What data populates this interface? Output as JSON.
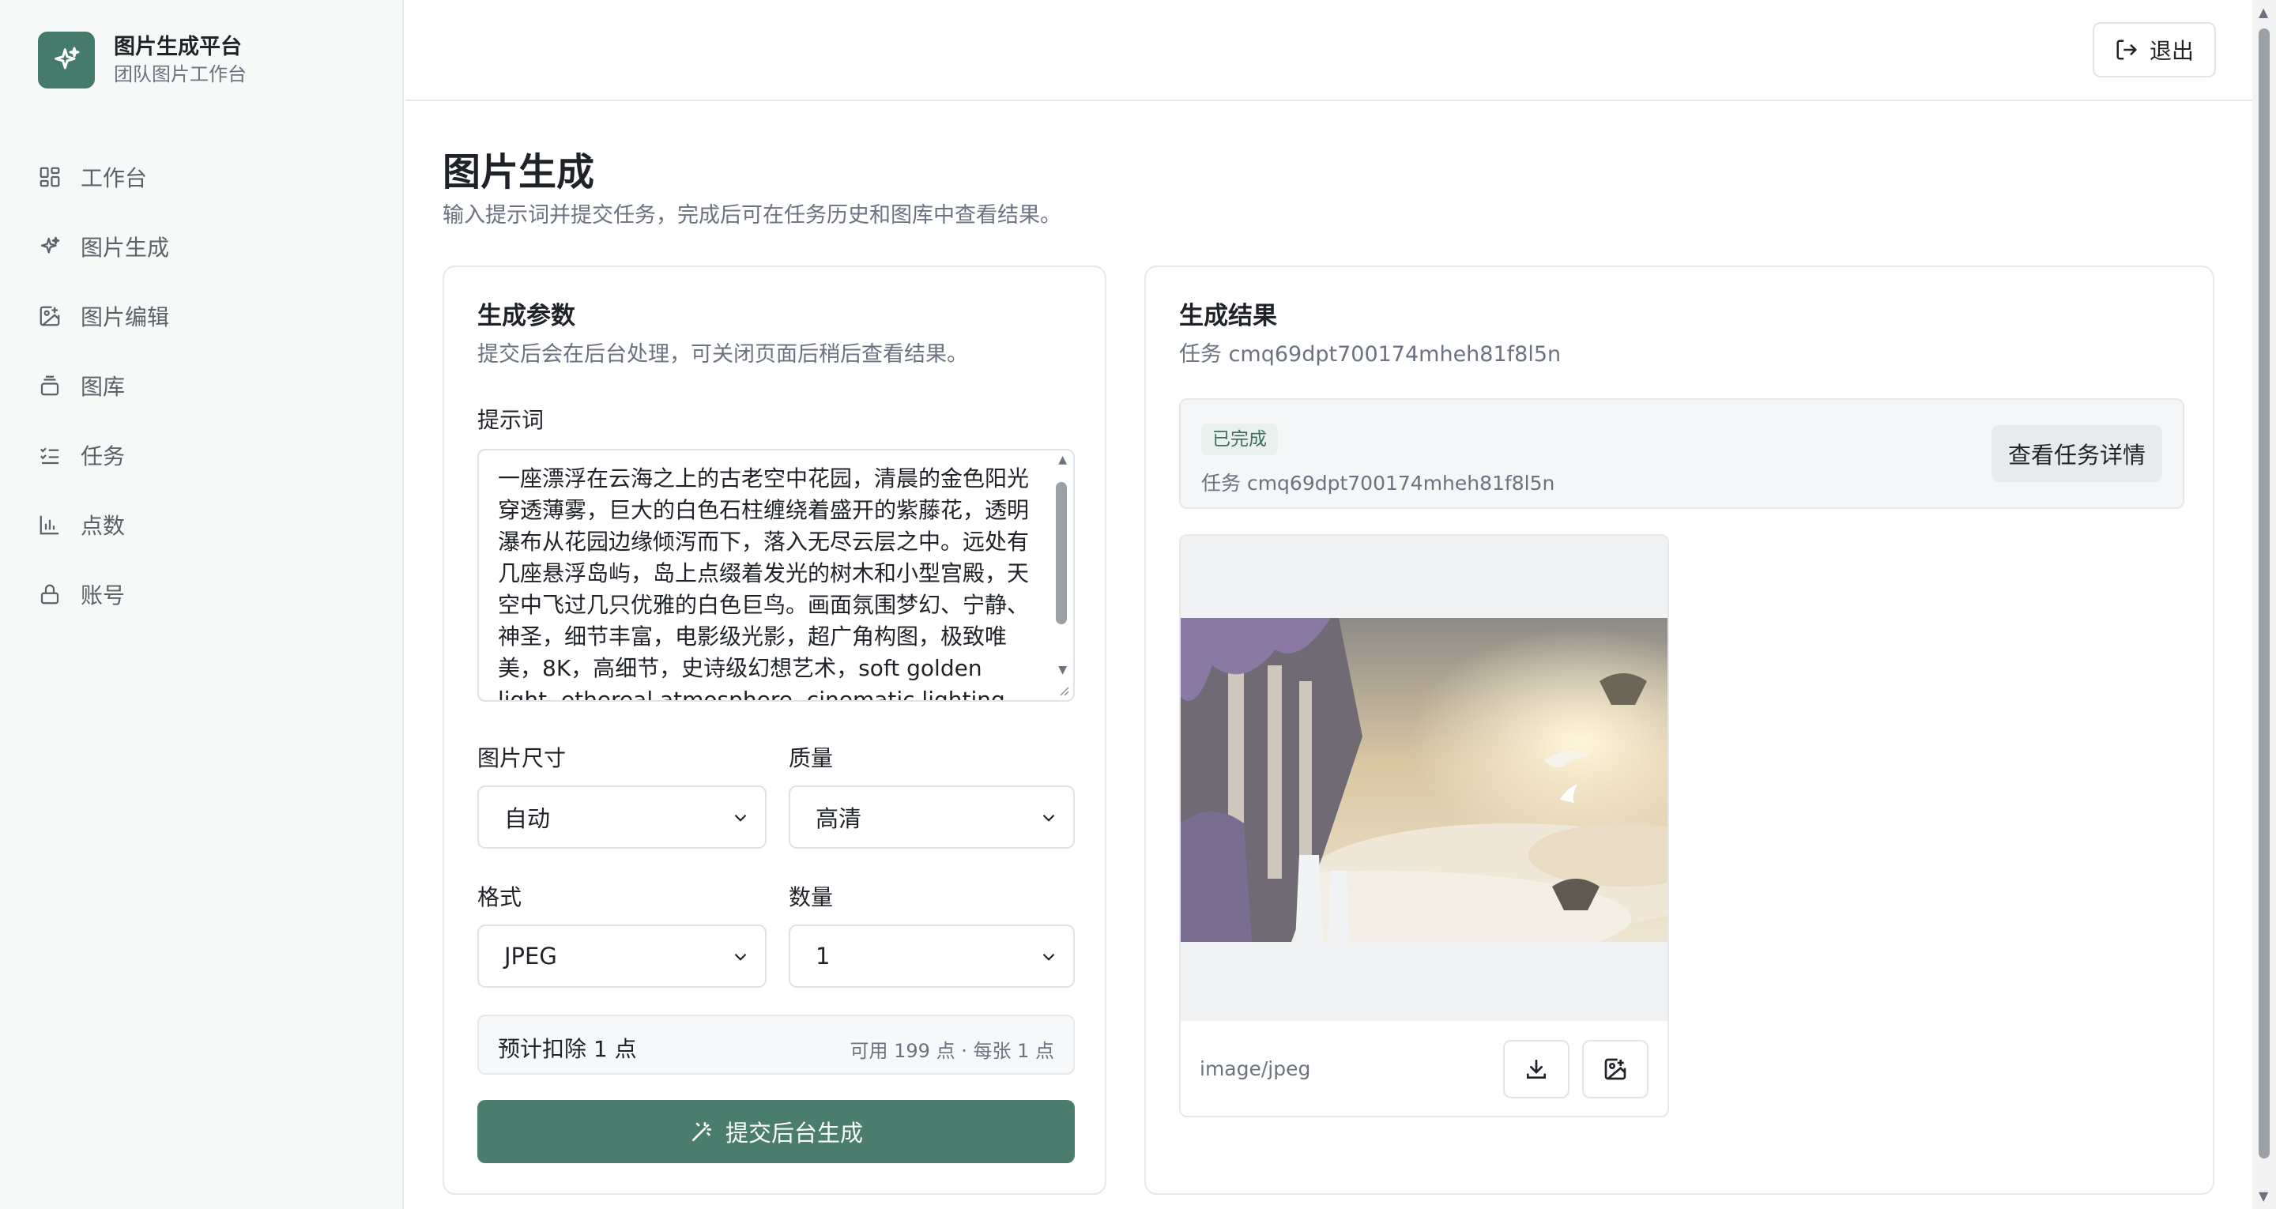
{
  "brand": {
    "title": "图片生成平台",
    "subtitle": "团队图片工作台"
  },
  "sidebar": {
    "items": [
      {
        "label": "工作台",
        "icon": "dashboard-icon"
      },
      {
        "label": "图片生成",
        "icon": "sparkles-icon"
      },
      {
        "label": "图片编辑",
        "icon": "image-edit-icon"
      },
      {
        "label": "图库",
        "icon": "gallery-icon"
      },
      {
        "label": "任务",
        "icon": "task-list-icon"
      },
      {
        "label": "点数",
        "icon": "bar-chart-icon"
      },
      {
        "label": "账号",
        "icon": "lock-icon"
      }
    ]
  },
  "header": {
    "logout_label": "退出"
  },
  "page": {
    "title": "图片生成",
    "subtitle": "输入提示词并提交任务，完成后可在任务历史和图库中查看结果。"
  },
  "params": {
    "title": "生成参数",
    "subtitle": "提交后会在后台处理，可关闭页面后稍后查看结果。",
    "prompt_label": "提示词",
    "prompt_value": "一座漂浮在云海之上的古老空中花园，清晨的金色阳光穿透薄雾，巨大的白色石柱缠绕着盛开的紫藤花，透明瀑布从花园边缘倾泻而下，落入无尽云层之中。远处有几座悬浮岛屿，岛上点缀着发光的树木和小型宫殿，天空中飞过几只优雅的白色巨鸟。画面氛围梦幻、宁静、神圣，细节丰富，电影级光影，超广角构图，极致唯美，8K，高细节，史诗级幻想艺术，soft golden light, ethereal atmosphere, cinematic lighting",
    "size_label": "图片尺寸",
    "size_value": "自动",
    "quality_label": "质量",
    "quality_value": "高清",
    "format_label": "格式",
    "format_value": "JPEG",
    "count_label": "数量",
    "count_value": "1",
    "cost_main": "预计扣除 1 点",
    "cost_side": "可用 199 点 · 每张 1 点",
    "submit_label": "提交后台生成"
  },
  "result": {
    "title": "生成结果",
    "task_line": "任务 cmq69dpt700174mheh81f8l5n",
    "status_badge": "已完成",
    "status_task": "任务 cmq69dpt700174mheh81f8l5n",
    "detail_label": "查看任务详情",
    "mime": "image/jpeg"
  },
  "colors": {
    "accent": "#4b7d6e",
    "brand": "#467a6c",
    "badge_bg": "#e9f1ee",
    "badge_text": "#3c6e5f"
  }
}
